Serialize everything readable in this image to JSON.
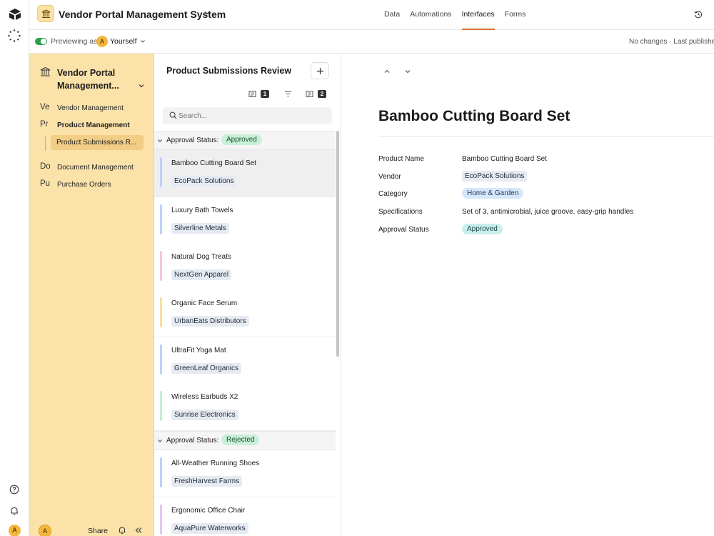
{
  "app": {
    "title": "Vendor Portal Management System",
    "nav_tabs": [
      "Data",
      "Automations",
      "Interfaces",
      "Forms"
    ],
    "active_tab": "Interfaces"
  },
  "preview": {
    "label": "Previewing as",
    "avatar_initial": "A",
    "user": "Yourself",
    "status": "No changes · Last publishe"
  },
  "sidebar": {
    "title": "Vendor Portal Management...",
    "items": [
      {
        "abbr": "Ve",
        "label": "Vendor Management"
      },
      {
        "abbr": "Pr",
        "label": "Product Management"
      },
      {
        "abbr": "Do",
        "label": "Document Management"
      },
      {
        "abbr": "Pu",
        "label": "Purchase Orders"
      }
    ],
    "sub_item": "Product Submissions R...",
    "footer": {
      "avatar_initial": "A",
      "share_label": "Share"
    }
  },
  "rail": {
    "avatar_initial": "A"
  },
  "list": {
    "title": "Product Submissions Review",
    "tool_counts": [
      "1",
      "2"
    ],
    "search_placeholder": "Search...",
    "groups": [
      {
        "label": "Approval Status:",
        "status": "Approved",
        "records": [
          {
            "name": "Bamboo Cutting Board Set",
            "vendor": "EcoPack Solutions",
            "color": "#b9d3f7",
            "selected": true
          },
          {
            "name": "Luxury Bath Towels",
            "vendor": "Silverline Metals",
            "color": "#b9d3f7"
          },
          {
            "name": "Natural Dog Treats",
            "vendor": "NextGen Apparel",
            "color": "#f6c5d8"
          },
          {
            "name": "Organic Face Serum",
            "vendor": "UrbanEats Distributors",
            "color": "#f7dfa0"
          },
          {
            "name": "UltraFit Yoga Mat",
            "vendor": "GreenLeaf Organics",
            "color": "#b9d3f7"
          },
          {
            "name": "Wireless Earbuds X2",
            "vendor": "Sunrise Electronics",
            "color": "#c5ecd1"
          }
        ]
      },
      {
        "label": "Approval Status:",
        "status": "Rejected",
        "records": [
          {
            "name": "All-Weather Running Shoes",
            "vendor": "FreshHarvest Farms",
            "color": "#b9d3f7"
          },
          {
            "name": "Ergonomic Office Chair",
            "vendor": "AquaPure Waterworks",
            "color": "#e7c5f3"
          }
        ]
      }
    ]
  },
  "detail": {
    "title": "Bamboo Cutting Board Set",
    "fields": [
      {
        "label": "Product Name",
        "value": "Bamboo Cutting Board Set",
        "style": "text"
      },
      {
        "label": "Vendor",
        "value": "EcoPack Solutions",
        "style": "tag"
      },
      {
        "label": "Category",
        "value": "Home & Garden",
        "style": "pill-blue"
      },
      {
        "label": "Specifications",
        "value": "Set of 3, antimicrobial, juice groove, easy-grip handles",
        "style": "text"
      },
      {
        "label": "Approval Status",
        "value": "Approved",
        "style": "pill-teal"
      }
    ]
  },
  "colors": {
    "sidebar_bg": "#fbe2a9",
    "active_tab_underline": "#d9702d",
    "approved_pill": "#c8eeeb",
    "rejected_pill": "#c9f0d7"
  }
}
